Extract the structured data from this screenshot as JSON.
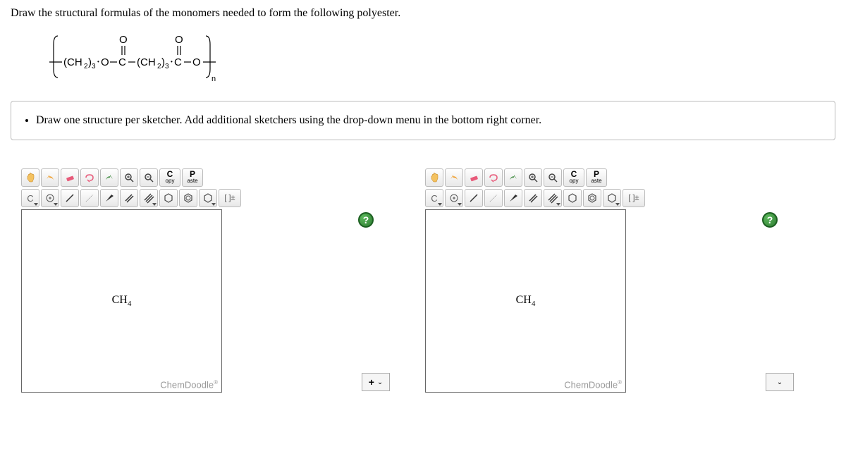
{
  "question": {
    "prompt": "Draw the structural formulas of the monomers needed to form the following polyester.",
    "formula_text": "(CH₂)₃-O-C(=O)-(CH₂)₃-C(=O)-O",
    "instruction": "Draw one structure per sketcher. Add additional sketchers using the drop-down menu in the bottom right corner."
  },
  "toolbar": {
    "copy_top": "C",
    "copy_bottom": "opy",
    "paste_top": "P",
    "paste_bottom": "aste",
    "c_label": "C",
    "brackets": "[ ]±"
  },
  "sketcher": {
    "default_molecule": "CH",
    "default_subscript": "4",
    "brand": "ChemDoodle",
    "brand_mark": "®",
    "help": "?"
  },
  "controls": {
    "add": "+",
    "add_caret": "⌄",
    "dropdown_caret": "⌄"
  }
}
